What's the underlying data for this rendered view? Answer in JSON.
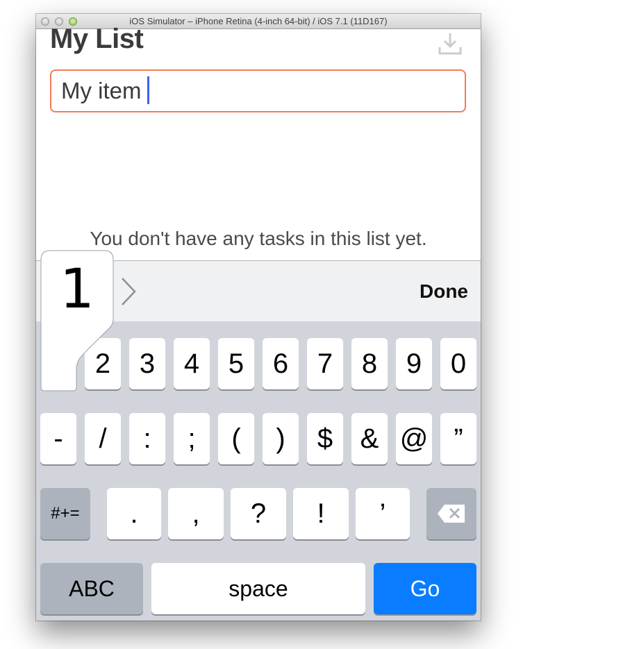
{
  "window": {
    "title": "iOS Simulator – iPhone Retina (4-inch 64-bit) / iOS 7.1 (11D167)"
  },
  "app": {
    "title": "My List",
    "input_value": "My item",
    "empty_message": "You don't have any tasks in this list yet.",
    "download_icon": "download-tray-icon",
    "accent_color": "#f27b57",
    "caret_color": "#3d63e8"
  },
  "accessory": {
    "next_icon": "chevron-right-icon",
    "done_label": "Done"
  },
  "keyboard": {
    "popup_key": "1",
    "row1": [
      "2",
      "3",
      "4",
      "5",
      "6",
      "7",
      "8",
      "9",
      "0"
    ],
    "row2": [
      "-",
      "/",
      ":",
      ";",
      "(",
      ")",
      "$",
      "&",
      "@",
      "”"
    ],
    "row3": [
      ".",
      ",",
      "?",
      "!",
      "’"
    ],
    "symbols_label": "#+=",
    "delete_icon": "backspace-icon",
    "abc_label": "ABC",
    "space_label": "space",
    "go_label": "Go",
    "go_color": "#0a7cff"
  }
}
